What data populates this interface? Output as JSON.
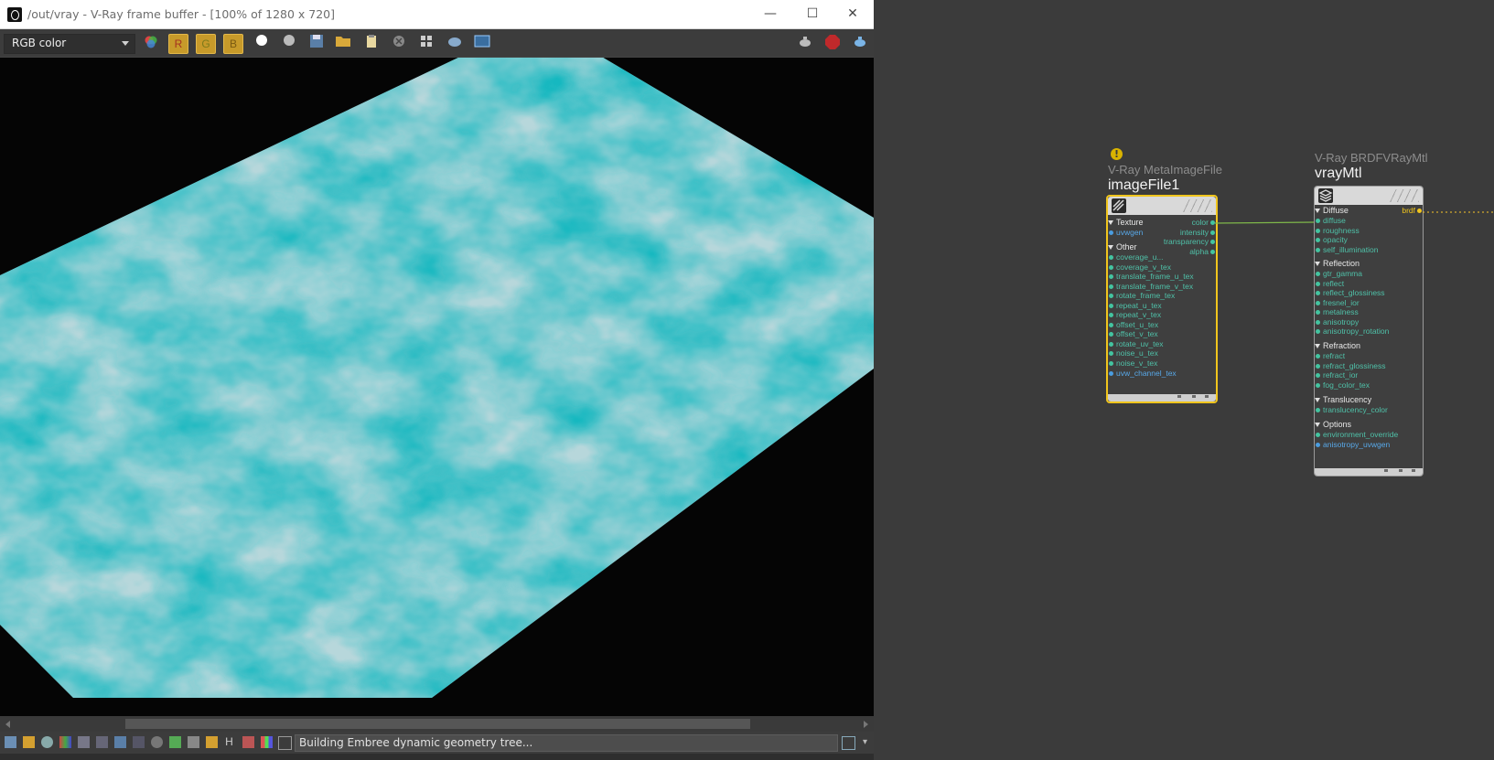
{
  "window": {
    "title": "/out/vray - V-Ray frame buffer - [100% of 1280 x 720]",
    "minimize_glyph": "—",
    "maximize_glyph": "☐",
    "close_glyph": "✕"
  },
  "toolbar": {
    "channel": "RGB color",
    "r_label": "R",
    "g_label": "G",
    "b_label": "B"
  },
  "status": {
    "message": "Building Embree dynamic geometry tree..."
  },
  "status_icons": [
    "H"
  ],
  "nodes": {
    "image_file": {
      "type": "V-Ray MetaImageFile",
      "name": "imageFile1",
      "warning_glyph": "!",
      "sections": {
        "texture": "Texture",
        "other": "Other"
      },
      "inputs_texture": [
        "uvwgen"
      ],
      "inputs_other": [
        "coverage_u...",
        "coverage_v_tex",
        "translate_frame_u_tex",
        "translate_frame_v_tex",
        "rotate_frame_tex",
        "repeat_u_tex",
        "repeat_v_tex",
        "offset_u_tex",
        "offset_v_tex",
        "rotate_uv_tex",
        "noise_u_tex",
        "noise_v_tex",
        "uvw_channel_tex"
      ],
      "outputs": [
        "color",
        "intensity",
        "transparency",
        "alpha"
      ]
    },
    "vray_mtl": {
      "type": "V-Ray BRDFVRayMtl",
      "name": "vrayMtl",
      "output": "brdf",
      "sections": {
        "diffuse": "Diffuse",
        "reflection": "Reflection",
        "refraction": "Refraction",
        "translucency": "Translucency",
        "options": "Options"
      },
      "diffuse_inputs": [
        "diffuse",
        "roughness",
        "opacity",
        "self_illumination"
      ],
      "reflection_inputs": [
        "gtr_gamma",
        "reflect",
        "reflect_glossiness",
        "fresnel_ior",
        "metalness",
        "anisotropy",
        "anisotropy_rotation"
      ],
      "refraction_inputs": [
        "refract",
        "refract_glossiness",
        "refract_ior",
        "fog_color_tex"
      ],
      "translucency_inputs": [
        "translucency_color"
      ],
      "options_inputs": [
        "environment_override",
        "anisotropy_uvwgen"
      ]
    }
  },
  "colors": {
    "accent_selected": "#f0c51d",
    "port_green": "#43c4a0",
    "port_blue": "#4a9de0",
    "texture_cyan": "#16b8c0",
    "texture_light": "#b7d7db"
  }
}
